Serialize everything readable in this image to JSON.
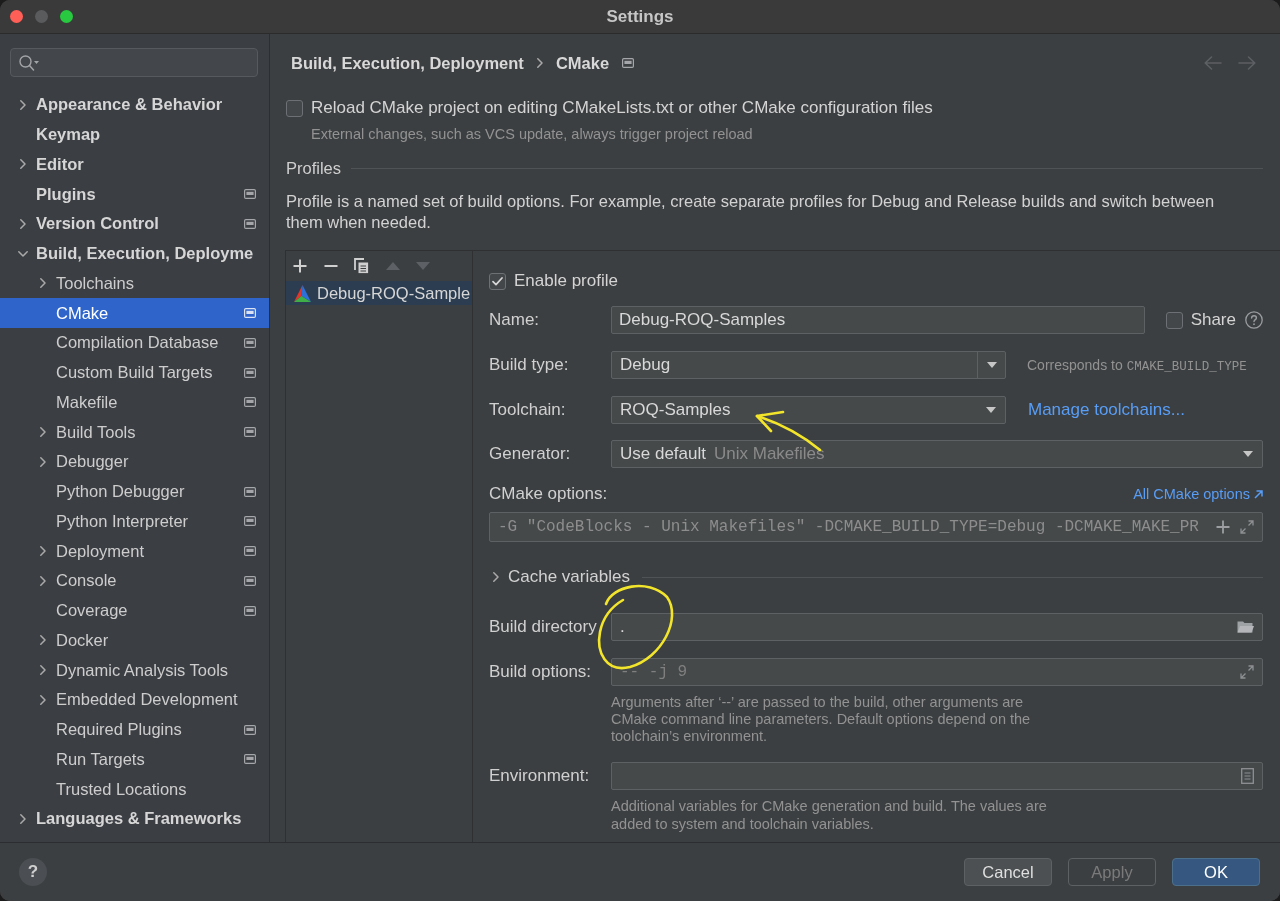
{
  "window": {
    "title": "Settings",
    "controls": [
      {
        "kind": "close",
        "disabled": false
      },
      {
        "kind": "minimize",
        "disabled": true
      },
      {
        "kind": "zoom",
        "disabled": false
      }
    ]
  },
  "sidebar": {
    "items": [
      {
        "label": "Appearance & Behavior",
        "kind": "group",
        "expanded": false,
        "project_level": false,
        "selected": false
      },
      {
        "label": "Keymap",
        "kind": "page",
        "project_level": false,
        "selected": false
      },
      {
        "label": "Editor",
        "kind": "group",
        "expanded": false,
        "project_level": false,
        "selected": false
      },
      {
        "label": "Plugins",
        "kind": "page",
        "project_level": true,
        "selected": false
      },
      {
        "label": "Version Control",
        "kind": "group",
        "expanded": false,
        "project_level": true,
        "selected": false
      },
      {
        "label": "Build, Execution, Deployme",
        "kind": "group",
        "expanded": true,
        "project_level": false,
        "selected": false,
        "children": [
          {
            "label": "Toolchains",
            "kind": "group",
            "expanded": false,
            "project_level": false,
            "selected": false
          },
          {
            "label": "CMake",
            "kind": "page",
            "project_level": true,
            "selected": true
          },
          {
            "label": "Compilation Database",
            "kind": "page",
            "project_level": true,
            "selected": false
          },
          {
            "label": "Custom Build Targets",
            "kind": "page",
            "project_level": true,
            "selected": false
          },
          {
            "label": "Makefile",
            "kind": "page",
            "project_level": true,
            "selected": false
          },
          {
            "label": "Build Tools",
            "kind": "group",
            "expanded": false,
            "project_level": true,
            "selected": false
          },
          {
            "label": "Debugger",
            "kind": "group",
            "expanded": false,
            "project_level": false,
            "selected": false
          },
          {
            "label": "Python Debugger",
            "kind": "page",
            "project_level": true,
            "selected": false
          },
          {
            "label": "Python Interpreter",
            "kind": "page",
            "project_level": true,
            "selected": false
          },
          {
            "label": "Deployment",
            "kind": "group",
            "expanded": false,
            "project_level": true,
            "selected": false
          },
          {
            "label": "Console",
            "kind": "group",
            "expanded": false,
            "project_level": true,
            "selected": false
          },
          {
            "label": "Coverage",
            "kind": "page",
            "project_level": true,
            "selected": false
          },
          {
            "label": "Docker",
            "kind": "group",
            "expanded": false,
            "project_level": false,
            "selected": false
          },
          {
            "label": "Dynamic Analysis Tools",
            "kind": "group",
            "expanded": false,
            "project_level": false,
            "selected": false
          },
          {
            "label": "Embedded Development",
            "kind": "group",
            "expanded": false,
            "project_level": false,
            "selected": false
          },
          {
            "label": "Required Plugins",
            "kind": "page",
            "project_level": true,
            "selected": false
          },
          {
            "label": "Run Targets",
            "kind": "page",
            "project_level": true,
            "selected": false
          },
          {
            "label": "Trusted Locations",
            "kind": "page",
            "project_level": false,
            "selected": false
          }
        ]
      },
      {
        "label": "Languages & Frameworks",
        "kind": "group",
        "expanded": false,
        "project_level": false,
        "selected": false
      }
    ]
  },
  "breadcrumb": {
    "items": [
      "Build, Execution, Deployment",
      "CMake"
    ],
    "project_level": true
  },
  "navigation": {
    "back": {
      "disabled": true
    },
    "forward": {
      "disabled": true
    }
  },
  "reload_option": {
    "label": "Reload CMake project on editing CMakeLists.txt or other CMake configuration files",
    "checked": false,
    "hint": "External changes, such as VCS update, always trigger project reload"
  },
  "profiles_section": {
    "title": "Profiles",
    "description": "Profile is a named set of build options. For example, create separate profiles for Debug and Release builds and switch between them when needed."
  },
  "profiles": {
    "toolbar": [
      {
        "kind": "add",
        "disabled": false
      },
      {
        "kind": "remove",
        "disabled": false
      },
      {
        "kind": "copy",
        "disabled": false
      },
      {
        "kind": "move_up",
        "disabled": true
      },
      {
        "kind": "move_down",
        "disabled": true
      }
    ],
    "list": [
      {
        "name": "Debug-ROQ-Sample",
        "selected": true
      }
    ],
    "form": {
      "enable_profile": {
        "label": "Enable profile",
        "checked": true
      },
      "name": {
        "label": "Name:",
        "value": "Debug-ROQ-Samples",
        "share": {
          "label": "Share",
          "checked": false
        }
      },
      "build_type": {
        "label": "Build type:",
        "value": "Debug",
        "hint": "Corresponds to",
        "hint_code": "CMAKE_BUILD_TYPE"
      },
      "toolchain": {
        "label": "Toolchain:",
        "value": "ROQ-Samples",
        "link": "Manage toolchains...",
        "annotation": {
          "kind": "arrow"
        }
      },
      "generator": {
        "label": "Generator:",
        "value": "Use default",
        "detail": "Unix Makefiles"
      },
      "cmake_options": {
        "label": "CMake options:",
        "link": "All CMake options",
        "value": "-G \"CodeBlocks - Unix Makefiles\" -DCMAKE_BUILD_TYPE=Debug -DCMAKE_MAKE_PR"
      },
      "cache_variables": {
        "label": "Cache variables",
        "expanded": false
      },
      "build_directory": {
        "label": "Build directory",
        "value": ".",
        "annotation": {
          "kind": "circle"
        }
      },
      "build_options": {
        "label": "Build options:",
        "placeholder": "-- -j 9",
        "hint": "Arguments after ‘--’ are passed to the build, other arguments are CMake command line parameters. Default options depend on the toolchain’s environment."
      },
      "environment": {
        "label": "Environment:",
        "hint": "Additional variables for CMake generation and build. The values are added to system and toolchain variables."
      }
    }
  },
  "footer": {
    "help": "?",
    "buttons": [
      {
        "label": "Cancel",
        "kind": "secondary",
        "disabled": false
      },
      {
        "label": "Apply",
        "kind": "secondary",
        "disabled": true
      },
      {
        "label": "OK",
        "kind": "primary",
        "disabled": false
      }
    ]
  }
}
